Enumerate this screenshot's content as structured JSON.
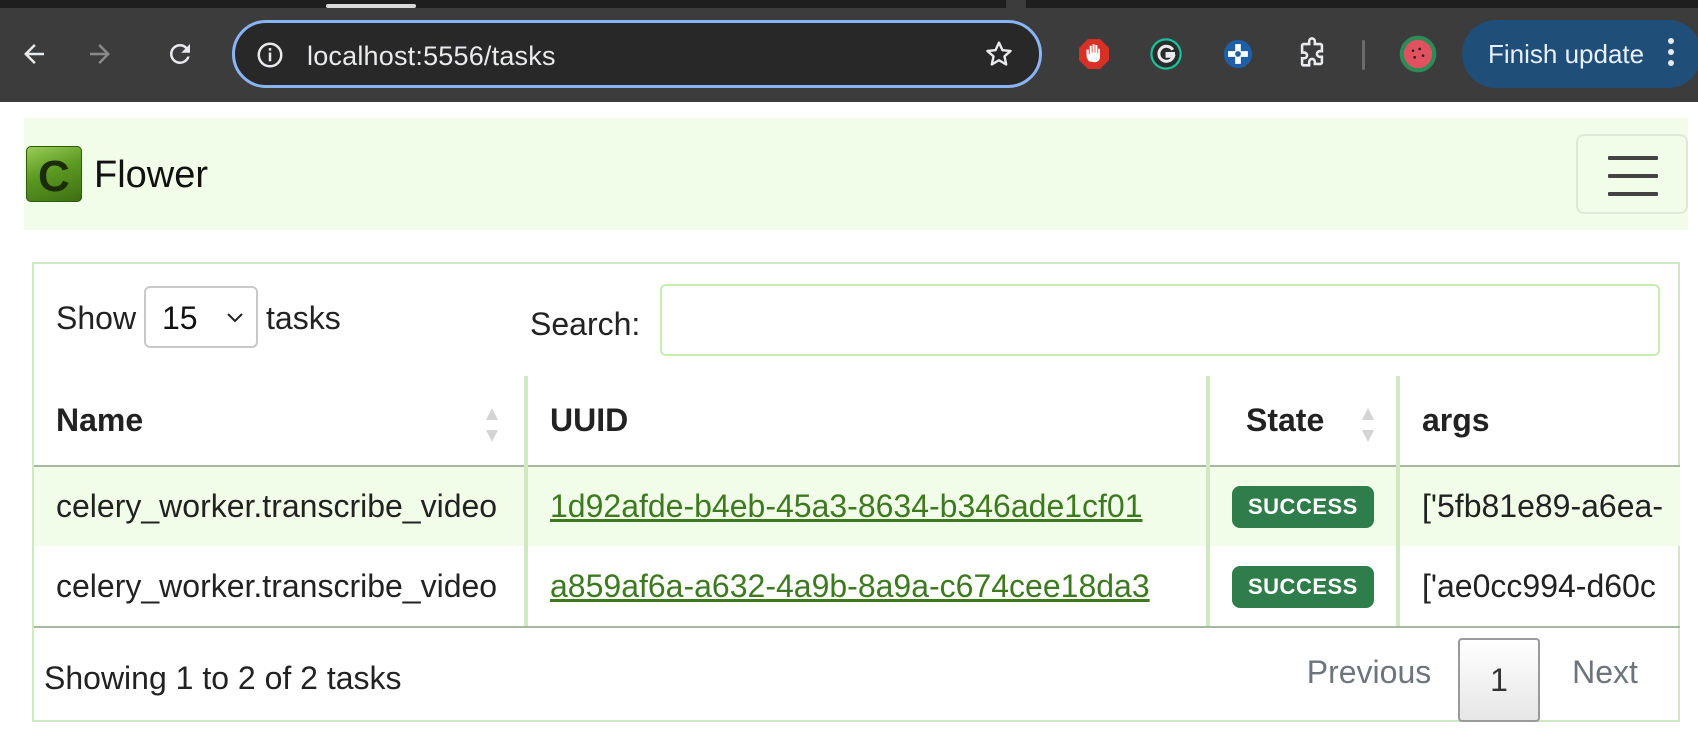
{
  "browser": {
    "url": "localhost:5556/tasks",
    "finish_update_label": "Finish update"
  },
  "navbar": {
    "brand_logo_letter": "C",
    "brand_name": "Flower"
  },
  "controls": {
    "show_label": "Show",
    "page_size": "15",
    "tasks_label": "tasks",
    "search_label": "Search:",
    "search_value": ""
  },
  "table": {
    "columns": [
      "Name",
      "UUID",
      "State",
      "args"
    ],
    "rows": [
      {
        "name": "celery_worker.transcribe_video",
        "uuid": "1d92afde-b4eb-45a3-8634-b346ade1cf01",
        "state": "SUCCESS",
        "args": "['5fb81e89-a6ea-"
      },
      {
        "name": "celery_worker.transcribe_video",
        "uuid": "a859af6a-a632-4a9b-8a9a-c674cee18da3",
        "state": "SUCCESS",
        "args": "['ae0cc994-d60c"
      }
    ]
  },
  "footer": {
    "info": "Showing 1 to 2 of 2 tasks",
    "previous": "Previous",
    "current_page": "1",
    "next": "Next"
  },
  "colors": {
    "navbar_bg": "#f2fde9",
    "link": "#3d7a1f",
    "success_badge": "#2f7d4a",
    "omnibox_focus": "#8ab4f8"
  }
}
